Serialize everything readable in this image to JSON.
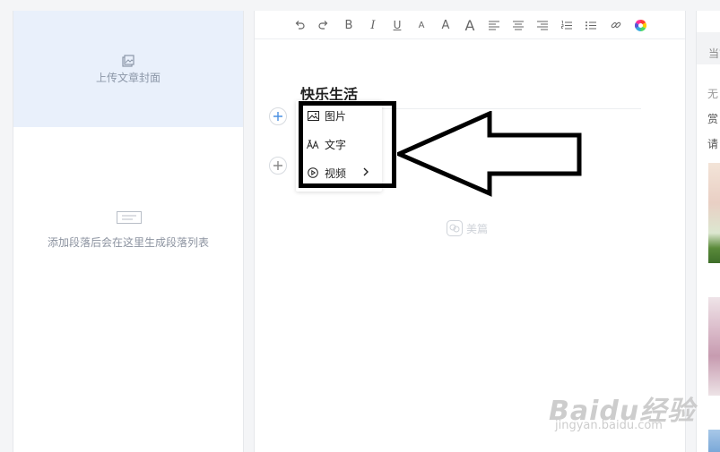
{
  "left_panel": {
    "cover_label": "上传文章封面",
    "paragraph_hint": "添加段落后会在这里生成段落列表"
  },
  "toolbar": {
    "items": [
      "undo-icon",
      "redo-icon",
      "bold-icon",
      "italic-icon",
      "underline-icon",
      "font-small-icon",
      "font-medium-icon",
      "font-large-icon",
      "align-left-icon",
      "align-center-icon",
      "align-right-icon",
      "ordered-list-icon",
      "unordered-list-icon",
      "link-icon",
      "color-wheel-icon"
    ],
    "bold": "B",
    "italic": "I",
    "underline": "U",
    "font_a": "A"
  },
  "editor": {
    "title": "快乐生活",
    "watermark": "美篇"
  },
  "insert_menu": {
    "items": [
      {
        "label": "图片",
        "icon": "image-icon"
      },
      {
        "label": "文字",
        "icon": "text-icon"
      },
      {
        "label": "视频",
        "icon": "video-icon"
      }
    ]
  },
  "right_panel": {
    "tab": "当前",
    "lines": [
      "无",
      "赏",
      "请"
    ]
  },
  "overlay": {
    "baidu_logo": "Baidu经验",
    "baidu_url": "jingyan.baidu.com"
  },
  "colors": {
    "cover_bg": "#e9f0fb",
    "accent": "#4a90e2",
    "annotation": "#000000"
  }
}
